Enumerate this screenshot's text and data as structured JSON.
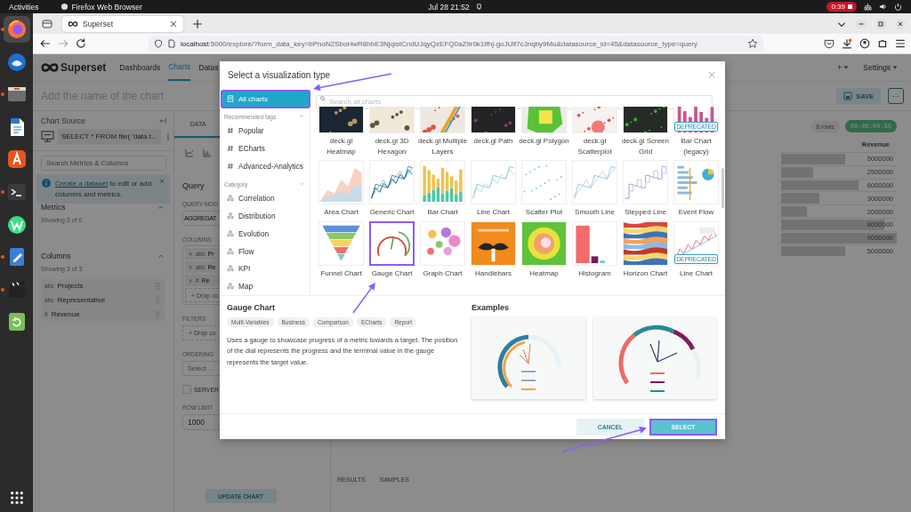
{
  "system_bar": {
    "activities": "Activities",
    "app_name": "Firefox Web Browser",
    "clock": "Jul 28  21:52",
    "recording": "0:39"
  },
  "dock": [
    {
      "kind": "firefox",
      "active": true,
      "running": true
    },
    {
      "kind": "thunderbird",
      "active": false,
      "running": false
    },
    {
      "kind": "files",
      "active": false,
      "running": true
    },
    {
      "kind": "writer",
      "active": false,
      "running": false
    },
    {
      "kind": "appcenter",
      "active": false,
      "running": false
    },
    {
      "kind": "terminal",
      "active": false,
      "running": true
    },
    {
      "kind": "android",
      "active": false,
      "running": false
    },
    {
      "kind": "editor",
      "active": false,
      "running": true
    },
    {
      "kind": "video",
      "active": false,
      "running": true
    },
    {
      "kind": "trash",
      "active": false,
      "running": false
    }
  ],
  "browser": {
    "tab_title": "Superset",
    "url_host": "localhost",
    "url_path": ":5000/explore/?form_data_key=bPnoN2SboHwR8hbE3NjqistCndUJqyQzEFQ0aZ9r0k1tfhj-goJUif7cJnqby9Mu&datasource_id=45&datasource_type=query"
  },
  "app": {
    "nav": {
      "brand": "Superset",
      "links": [
        {
          "label": "Dashboards",
          "selected": false
        },
        {
          "label": "Charts",
          "selected": true
        },
        {
          "label": "Datas",
          "selected": false
        }
      ],
      "new_label": "+",
      "settings": "Settings"
    },
    "header": {
      "title_placeholder": "Add the name of the chart",
      "save": "SAVE",
      "more": "···"
    },
    "data_panel": {
      "heading": "Chart Source",
      "source": "SELECT * FROM file( 'data.t...",
      "search_placeholder": "Search Metrics & Columns",
      "alert_link": "Create a dataset",
      "alert_text": " to edit or add columns and metrics.",
      "metrics_title": "Metrics",
      "metrics_count": "Showing 0 of 0",
      "columns_title": "Columns",
      "columns_count": "Showing 3 of 3",
      "columns": [
        {
          "type_label": "abc",
          "name": "Projects"
        },
        {
          "type_label": "abc",
          "name": "Representative"
        },
        {
          "type_label": "#",
          "name": "Revenue"
        }
      ]
    },
    "control": {
      "tab": "DATA",
      "section": "Query",
      "query_mode_label": "QUERY MOD",
      "query_mode": "AGGREGAT",
      "columns_label": "COLUMNS",
      "columns": [
        {
          "type_label": "abc",
          "name": "Pr"
        },
        {
          "type_label": "abc",
          "name": "Re"
        },
        {
          "type_label": "#",
          "name": "Re"
        }
      ],
      "columns_drop": "+ Drop co",
      "filters_label": "FILTERS",
      "filters_drop": "+ Drop co",
      "ordering_label": "ORDERING",
      "ordering_placeholder": "Select ...",
      "server_label": "SERVER",
      "server_checked": false,
      "row_limit_label": "ROW LIMIT",
      "row_limit": "1000",
      "update": "UPDATE CHART"
    },
    "results": {
      "row_count": "8 rows",
      "duration": "00:00:00.55",
      "column": "Revenue",
      "rows": [
        {
          "value": "5000000",
          "level": 0.556
        },
        {
          "value": "2500000",
          "level": 0.278
        },
        {
          "value": "6000000",
          "level": 0.667
        },
        {
          "value": "3000000",
          "level": 0.333
        },
        {
          "value": "2000000",
          "level": 0.222
        },
        {
          "value": "8000000",
          "level": 0.889
        },
        {
          "value": "9000000",
          "level": 1
        },
        {
          "value": "5000000",
          "level": 0.556
        }
      ],
      "tabs": [
        "RESULTS",
        "SAMPLES"
      ]
    }
  },
  "modal": {
    "title": "Select a visualization type",
    "search_placeholder": "Search all charts",
    "sidebar": {
      "all": {
        "label": "All charts",
        "selected": true
      },
      "groups": [
        {
          "title": "Recommended tags",
          "kind": "tag",
          "items": [
            {
              "label": "Popular",
              "selected": false
            },
            {
              "label": "ECharts",
              "selected": false
            },
            {
              "label": "Advanced-Analytics",
              "selected": false
            }
          ]
        },
        {
          "title": "Category",
          "kind": "category",
          "items": [
            {
              "label": "Correlation",
              "selected": false
            },
            {
              "label": "Distribution",
              "selected": false
            },
            {
              "label": "Evolution",
              "selected": false
            },
            {
              "label": "Flow",
              "selected": false
            },
            {
              "label": "KPI",
              "selected": false
            },
            {
              "label": "Map",
              "selected": false
            }
          ]
        }
      ]
    },
    "charts": [
      {
        "name": "deck.gl Heatmap",
        "selected": false
      },
      {
        "name": "deck.gl 3D Hexagon",
        "selected": false
      },
      {
        "name": "deck.gl Multiple Layers",
        "selected": false
      },
      {
        "name": "deck.gl Path",
        "selected": false
      },
      {
        "name": "deck.gl Polygon",
        "selected": false
      },
      {
        "name": "deck.gl Scatterplot",
        "selected": false
      },
      {
        "name": "deck.gl Screen Grid",
        "selected": false
      },
      {
        "name": "Bar Chart (legacy)",
        "selected": false,
        "badge": "DEPRECATED"
      },
      {
        "name": "Area Chart",
        "selected": false
      },
      {
        "name": "Generic Chart",
        "selected": false
      },
      {
        "name": "Bar Chart",
        "selected": false
      },
      {
        "name": "Line Chart",
        "selected": false
      },
      {
        "name": "Scatter Plot",
        "selected": false
      },
      {
        "name": "Smooth Line",
        "selected": false
      },
      {
        "name": "Stepped Line",
        "selected": false
      },
      {
        "name": "Event Flow",
        "selected": false
      },
      {
        "name": "Funnel Chart",
        "selected": false
      },
      {
        "name": "Gauge Chart",
        "selected": true
      },
      {
        "name": "Graph Chart",
        "selected": false
      },
      {
        "name": "Handlebars",
        "selected": false
      },
      {
        "name": "Heatmap",
        "selected": false
      },
      {
        "name": "Histogram",
        "selected": false
      },
      {
        "name": "Horizon Chart",
        "selected": false
      },
      {
        "name": "Line Chart",
        "selected": false,
        "badge": "DEPRECATED"
      }
    ],
    "detail": {
      "name": "Gauge Chart",
      "tags": [
        "Multi-Variables",
        "Business",
        "Comparison",
        "ECharts",
        "Report"
      ],
      "description": "Uses a gauge to showcase progress of a metric towards a target. The position of the dial represents the progress and the terminal value in the gauge represents the target value.",
      "examples_title": "Examples"
    },
    "buttons": {
      "cancel": "CANCEL",
      "select": "SELECT"
    }
  }
}
